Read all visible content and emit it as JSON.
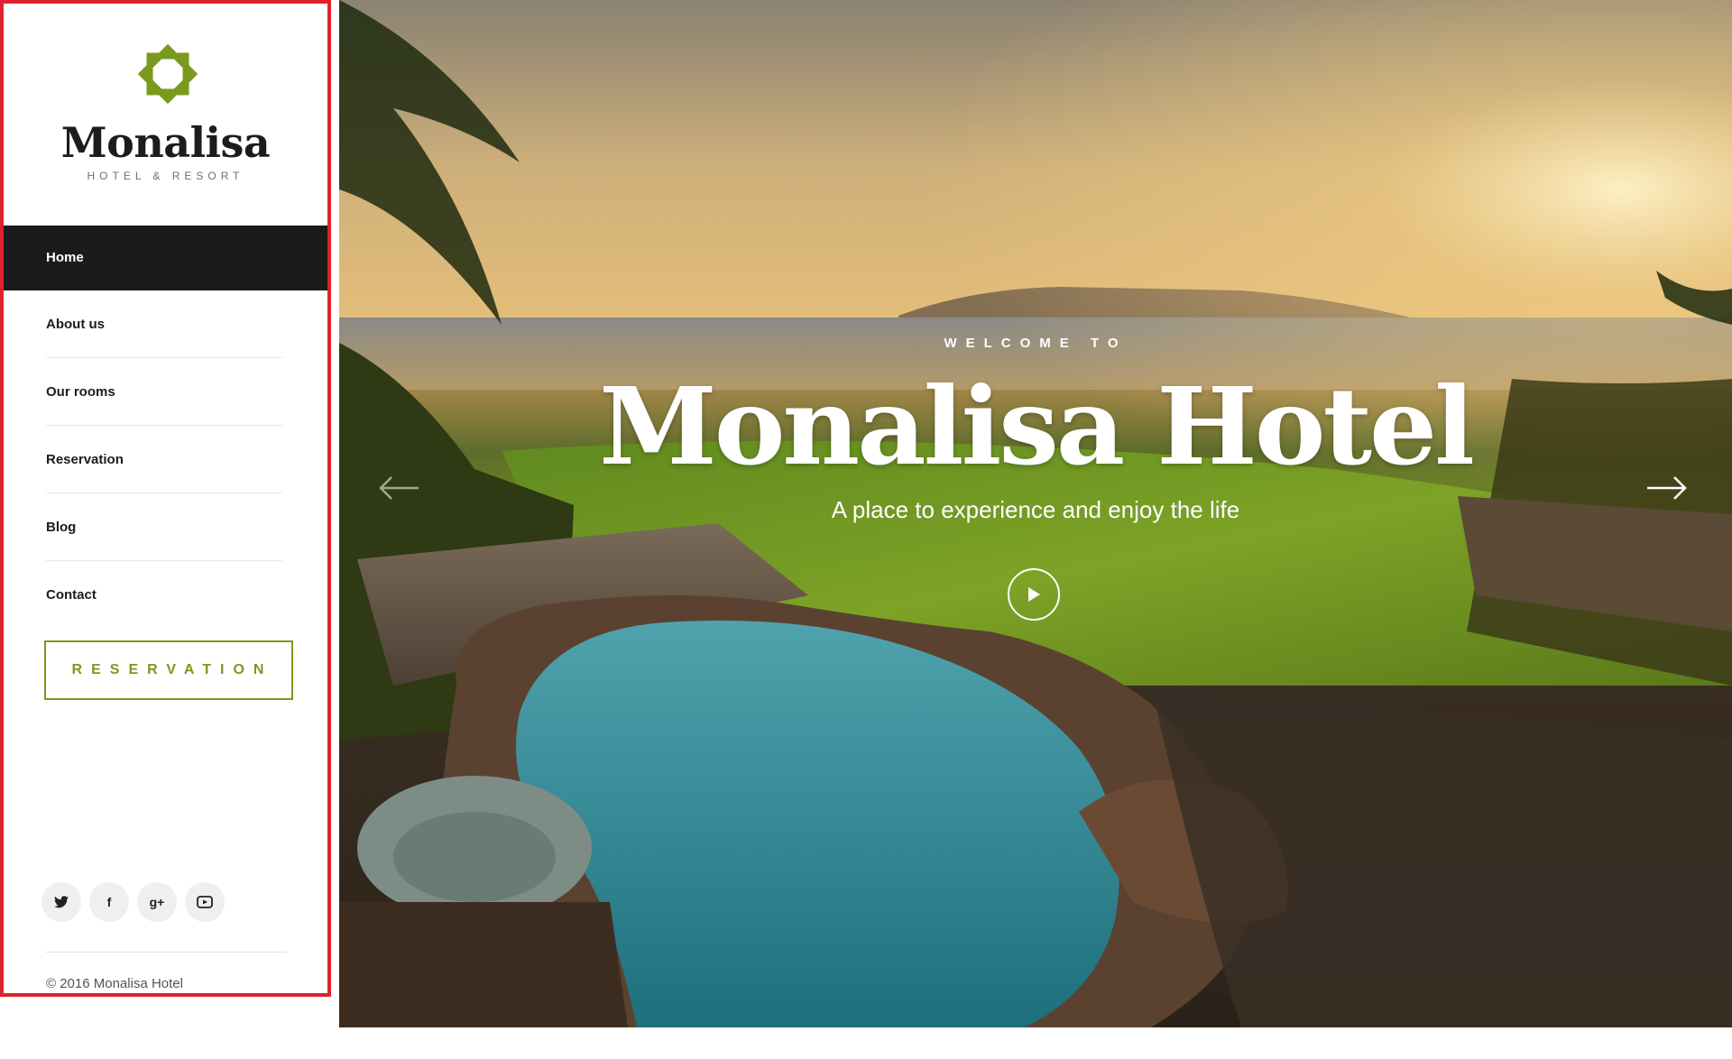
{
  "brand": {
    "name": "Monalisa",
    "tagline": "HOTEL & RESORT",
    "accent_color": "#7a9a1e",
    "logo_icon": "star-flower-logo-icon"
  },
  "nav": {
    "items": [
      {
        "label": "Home",
        "active": true
      },
      {
        "label": "About us",
        "active": false
      },
      {
        "label": "Our rooms",
        "active": false
      },
      {
        "label": "Reservation",
        "active": false
      },
      {
        "label": "Blog",
        "active": false
      },
      {
        "label": "Contact",
        "active": false
      }
    ]
  },
  "sidebar": {
    "reservation_button": "RESERVATION",
    "social": [
      {
        "icon": "twitter-icon"
      },
      {
        "icon": "facebook-icon",
        "glyph": "f"
      },
      {
        "icon": "google-plus-icon",
        "glyph": "g+"
      },
      {
        "icon": "youtube-icon"
      }
    ],
    "copyright": "© 2016 Monalisa Hotel"
  },
  "hero": {
    "eyebrow": "WELCOME TO",
    "title": "Monalisa Hotel",
    "subtitle": "A place to experience and enjoy the life",
    "play_icon": "play-icon",
    "prev_icon": "arrow-left-icon",
    "next_icon": "arrow-right-icon"
  }
}
